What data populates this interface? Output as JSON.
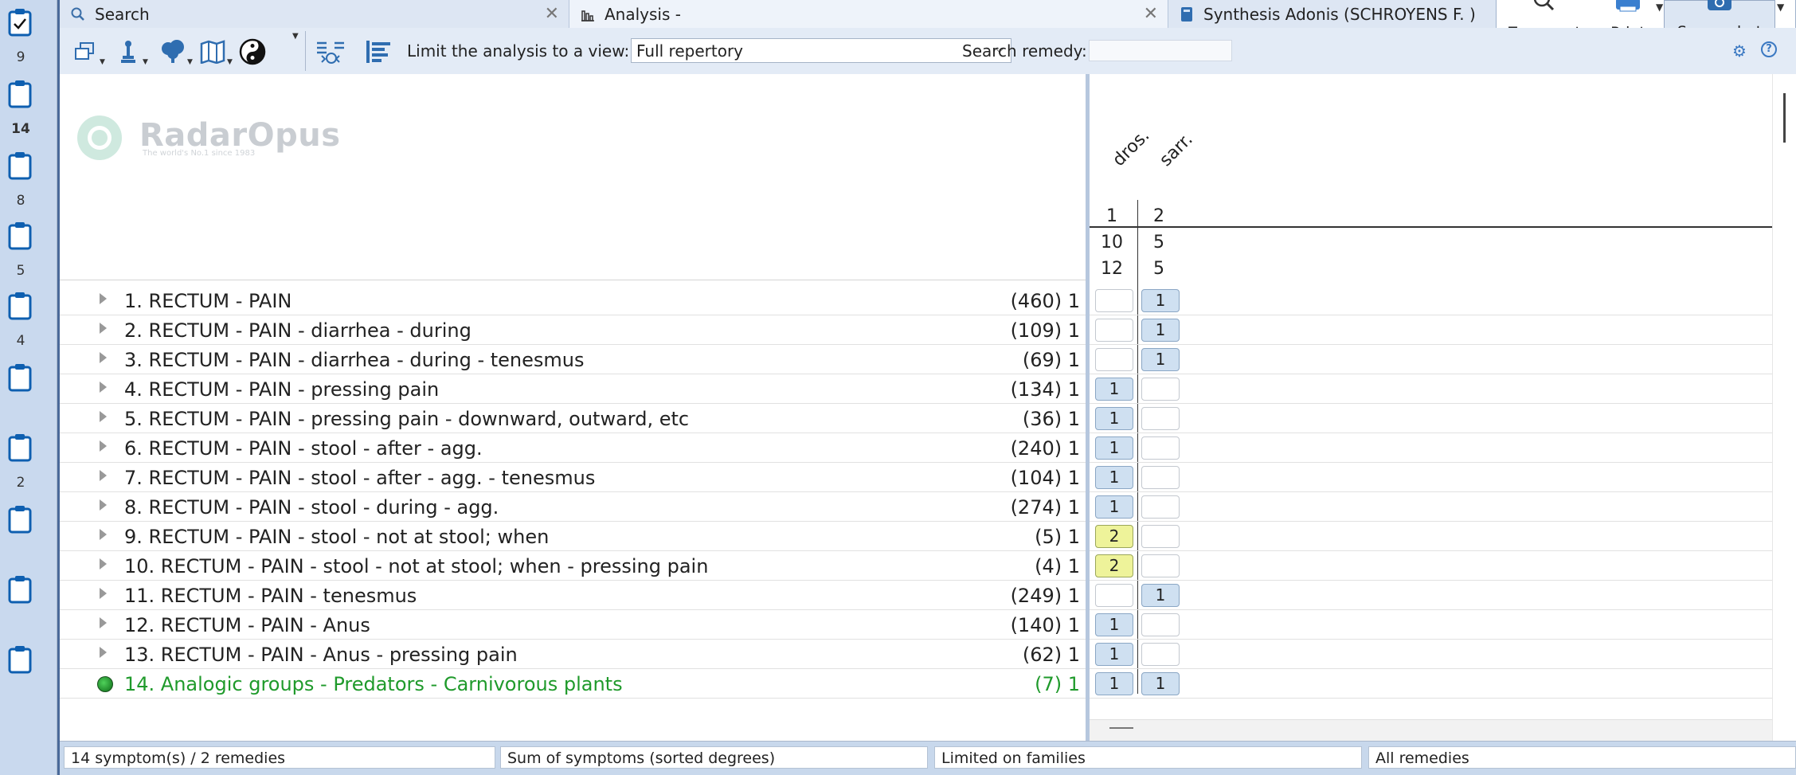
{
  "clipboards": [
    {
      "count": "9",
      "checked": true
    },
    {
      "count": "14",
      "active": true
    },
    {
      "count": "8"
    },
    {
      "count": "5"
    },
    {
      "count": "4"
    },
    {
      "count": ""
    },
    {
      "count": "2"
    },
    {
      "count": ""
    },
    {
      "count": ""
    },
    {
      "count": ""
    }
  ],
  "tabs": {
    "search": {
      "label": "Search",
      "close": "✕"
    },
    "analysis": {
      "label": "Analysis -",
      "close": "✕"
    },
    "synthesis": {
      "label": "Synthesis Adonis (SCHROYENS F. )"
    }
  },
  "ribbon": {
    "zoom_out": "Zoom out",
    "print": "Print",
    "screenshot": "Screenshot"
  },
  "toolbar": {
    "limit_label": "Limit the analysis to a view:",
    "view_value": "Full repertory",
    "search_remedy_label": "Search remedy:",
    "search_remedy_value": ""
  },
  "logo": {
    "name": "RadarOpus",
    "tagline": "The world's No.1 since 1983"
  },
  "symptoms": [
    {
      "text": "1. RECTUM - PAIN",
      "count": "(460) 1"
    },
    {
      "text": "2. RECTUM - PAIN - diarrhea - during",
      "count": "(109) 1"
    },
    {
      "text": "3. RECTUM - PAIN - diarrhea - during - tenesmus",
      "count": "(69) 1"
    },
    {
      "text": "4. RECTUM - PAIN - pressing pain",
      "count": "(134) 1"
    },
    {
      "text": "5. RECTUM - PAIN - pressing pain - downward, outward, etc",
      "count": "(36) 1"
    },
    {
      "text": "6. RECTUM - PAIN - stool - after - agg.",
      "count": "(240) 1"
    },
    {
      "text": "7. RECTUM - PAIN - stool - after - agg. - tenesmus",
      "count": "(104) 1"
    },
    {
      "text": "8. RECTUM - PAIN - stool - during - agg.",
      "count": "(274) 1"
    },
    {
      "text": "9. RECTUM - PAIN - stool - not at stool; when",
      "count": "(5) 1"
    },
    {
      "text": "10. RECTUM - PAIN - stool - not at stool; when - pressing pain",
      "count": "(4) 1"
    },
    {
      "text": "11. RECTUM - PAIN - tenesmus",
      "count": "(249) 1"
    },
    {
      "text": "12. RECTUM - PAIN - Anus",
      "count": "(140) 1"
    },
    {
      "text": "13. RECTUM - PAIN - Anus - pressing pain",
      "count": "(62) 1"
    },
    {
      "text": "14. Analogic groups - Predators - Carnivorous plants",
      "count": "(7) 1"
    }
  ],
  "remedies": {
    "names": [
      "dros.",
      "sarr."
    ],
    "rank": [
      "1",
      "2"
    ],
    "row_a": [
      "10",
      "5"
    ],
    "row_b": [
      "12",
      "5"
    ]
  },
  "grid": [
    [
      "",
      "1"
    ],
    [
      "",
      "1"
    ],
    [
      "",
      "1"
    ],
    [
      "1",
      ""
    ],
    [
      "1",
      ""
    ],
    [
      "1",
      ""
    ],
    [
      "1",
      ""
    ],
    [
      "1",
      ""
    ],
    [
      "2",
      ""
    ],
    [
      "2",
      ""
    ],
    [
      "",
      "1"
    ],
    [
      "1",
      ""
    ],
    [
      "1",
      ""
    ],
    [
      "1",
      "1"
    ]
  ],
  "status": {
    "symptoms": "14 symptom(s) / 2 remedies",
    "sort": "Sum of symptoms (sorted degrees)",
    "limit": "Limited on families",
    "remedies": "All remedies"
  },
  "icons": {
    "search": "magnifier-icon",
    "analysis": "bar-chart-icon",
    "synthesis": "book-icon",
    "gear": "gear-icon",
    "help": "help-icon"
  },
  "colors": {
    "accent": "#3a78c2",
    "green_symptom": "#1f9a2b",
    "grade1": "#cfe0f1",
    "grade2": "#eef39a"
  }
}
